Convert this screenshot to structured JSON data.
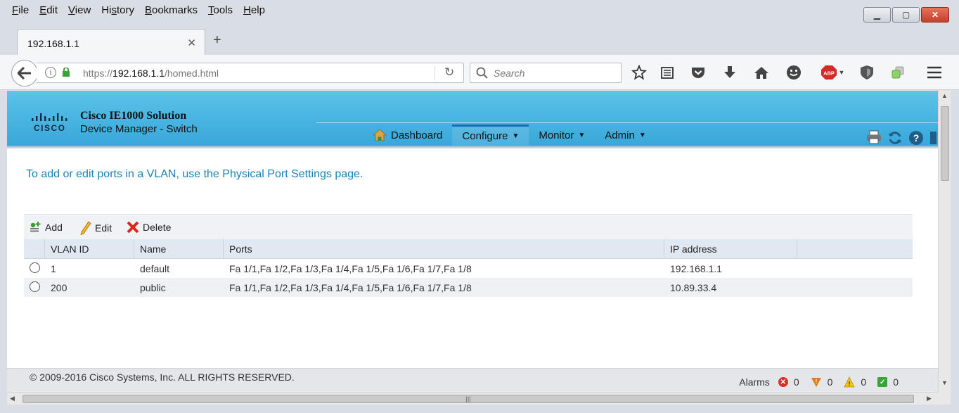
{
  "browser": {
    "menu": [
      "File",
      "Edit",
      "View",
      "History",
      "Bookmarks",
      "Tools",
      "Help"
    ],
    "menu_accel": [
      "F",
      "E",
      "V",
      "s",
      "B",
      "T",
      "H"
    ],
    "tab_title": "192.168.1.1",
    "url_prefix": "https://",
    "url_host": "192.168.1.1",
    "url_path": "/homed.html",
    "search_placeholder": "Search"
  },
  "app": {
    "brand_line1": "Cisco IE1000 Solution",
    "brand_line2": "Device Manager - Switch",
    "logo_text": "CISCO",
    "nav": [
      {
        "label": "Dashboard"
      },
      {
        "label": "Configure"
      },
      {
        "label": "Monitor"
      },
      {
        "label": "Admin"
      }
    ]
  },
  "page": {
    "notice": "To add or edit ports in a VLAN, use the Physical Port Settings page.",
    "toolbar": {
      "add": "Add",
      "edit": "Edit",
      "delete": "Delete"
    },
    "table": {
      "headers": [
        "VLAN ID",
        "Name",
        "Ports",
        "IP address"
      ],
      "rows": [
        {
          "vlan_id": "1",
          "name": "default",
          "ports": "Fa 1/1,Fa 1/2,Fa 1/3,Fa 1/4,Fa 1/5,Fa 1/6,Fa 1/7,Fa 1/8",
          "ip": "192.168.1.1"
        },
        {
          "vlan_id": "200",
          "name": "public",
          "ports": "Fa 1/1,Fa 1/2,Fa 1/3,Fa 1/4,Fa 1/5,Fa 1/6,Fa 1/7,Fa 1/8",
          "ip": "10.89.33.4"
        }
      ]
    }
  },
  "footer": {
    "copyright": "© 2009-2016 Cisco Systems, Inc. ALL RIGHTS RESERVED.",
    "alarms_label": "Alarms",
    "alarms": {
      "critical": "0",
      "major": "0",
      "minor": "0",
      "ok": "0"
    }
  },
  "colors": {
    "header_top": "#5cc3ea",
    "header_bottom": "#37a6d9",
    "link": "#1b83b5",
    "alarm_critical": "#d9302c",
    "alarm_major": "#e07b1a",
    "alarm_minor": "#f2c21c",
    "alarm_ok": "#3aa335"
  },
  "icons": [
    "back-arrow-icon",
    "info-icon",
    "lock-icon",
    "reload-icon",
    "search-icon",
    "bookmark-star-icon",
    "reading-list-icon",
    "pocket-icon",
    "download-icon",
    "home-icon",
    "smiley-icon",
    "adblock-icon",
    "shield-icon",
    "extension-icon",
    "hamburger-menu-icon",
    "house-icon",
    "print-icon",
    "refresh-icon",
    "help-icon"
  ]
}
